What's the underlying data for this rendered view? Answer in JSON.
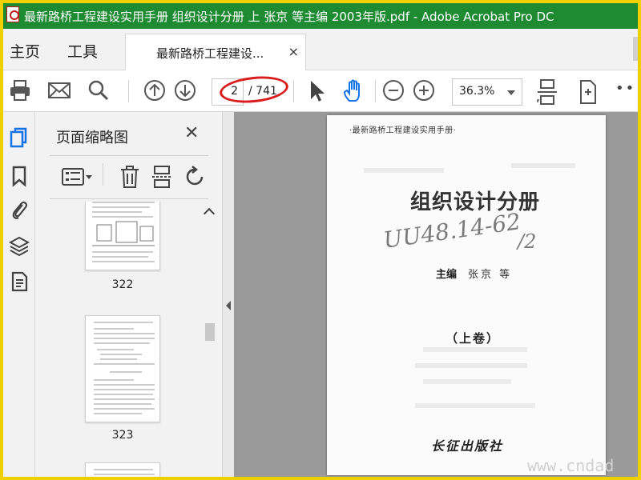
{
  "window": {
    "title": "最新路桥工程建设实用手册 组织设计分册 上 张京 等主编 2003年版.pdf - Adobe Acrobat Pro DC"
  },
  "tabs": {
    "home": "主页",
    "tools": "工具",
    "document": "最新路桥工程建设...",
    "close": "×"
  },
  "toolbar": {
    "page_current": "2",
    "page_total": "/ 741",
    "zoom": "36.3%",
    "more": "•••"
  },
  "thumbnails": {
    "heading": "页面缩略图",
    "close": "✕",
    "pages": [
      {
        "label": "322"
      },
      {
        "label": "323"
      },
      {
        "label": ""
      }
    ]
  },
  "document_page": {
    "header": "·最新路桥工程建设实用手册·",
    "title": "组织设计分册",
    "handwriting": "UU48.14-62",
    "handwriting2": "/2",
    "editor_label": "主编",
    "editor_names": "张京 等",
    "volume": "（上卷）",
    "publisher": "长征出版社"
  },
  "watermark": "www.cndad",
  "colors": {
    "title_bar": "#1e8b33",
    "frame": "#f0d000",
    "annotation_ellipse": "#d81b1b",
    "rail_active": "#1473e6"
  }
}
